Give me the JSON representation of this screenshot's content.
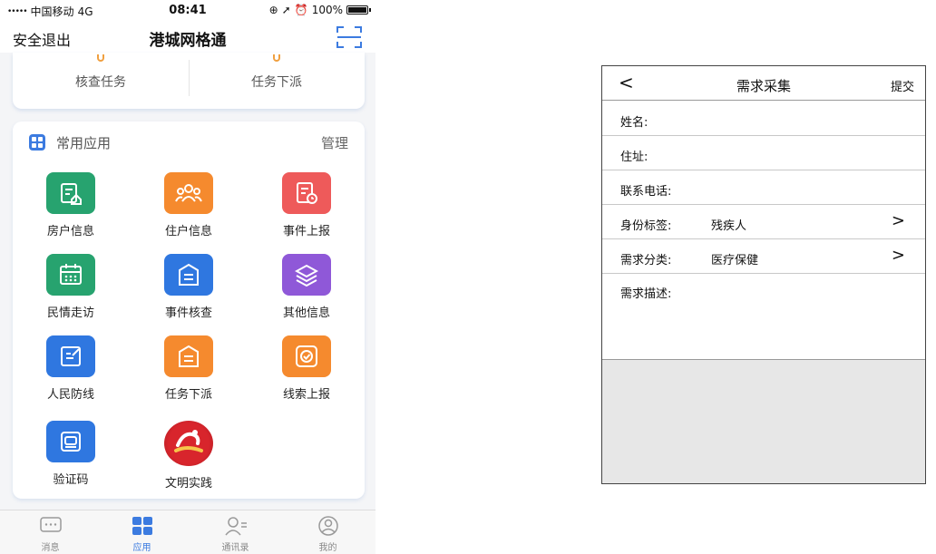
{
  "status_bar": {
    "signal": "•••••",
    "carrier": "中国移动",
    "network": "4G",
    "time": "08:41",
    "battery": "100%"
  },
  "nav": {
    "exit": "安全退出",
    "title": "港城网格通",
    "scan_icon": "scan-icon"
  },
  "top_card": {
    "items": [
      {
        "label": "核查任务"
      },
      {
        "label": "任务下派"
      }
    ]
  },
  "apps": {
    "title": "常用应用",
    "manage": "管理",
    "items": [
      {
        "label": "房户信息",
        "color": "#27a36f",
        "icon": "house-info-icon"
      },
      {
        "label": "住户信息",
        "color": "#f58a2e",
        "icon": "residents-icon"
      },
      {
        "label": "事件上报",
        "color": "#ee5a5a",
        "icon": "event-report-icon"
      },
      {
        "label": "民情走访",
        "color": "#27a36f",
        "icon": "calendar-icon"
      },
      {
        "label": "事件核查",
        "color": "#2f77e0",
        "icon": "clipboard-icon"
      },
      {
        "label": "其他信息",
        "color": "#8f58d8",
        "icon": "layers-icon"
      },
      {
        "label": "人民防线",
        "color": "#2f77e0",
        "icon": "edit-icon"
      },
      {
        "label": "任务下派",
        "color": "#f58a2e",
        "icon": "clipboard-icon"
      },
      {
        "label": "线索上报",
        "color": "#f58a2e",
        "icon": "check-circle-icon"
      },
      {
        "label": "验证码",
        "color": "#2f77e0",
        "icon": "inbox-icon"
      },
      {
        "label": "文明实践",
        "color": "#d8252c",
        "icon": "civilization-logo-icon"
      }
    ]
  },
  "tabbar": {
    "items": [
      {
        "label": "消息",
        "icon": "message-icon",
        "active": false
      },
      {
        "label": "应用",
        "icon": "apps-grid-icon",
        "active": true
      },
      {
        "label": "通讯录",
        "icon": "contacts-icon",
        "active": false
      },
      {
        "label": "我的",
        "icon": "profile-icon",
        "active": false
      }
    ]
  },
  "form": {
    "back": "<",
    "title": "需求采集",
    "submit": "提交",
    "rows": [
      {
        "key": "姓名:",
        "value": ""
      },
      {
        "key": "住址:",
        "value": ""
      },
      {
        "key": "联系电话:",
        "value": ""
      },
      {
        "key": "身份标签:",
        "value": "残疾人",
        "arrow": ">"
      },
      {
        "key": "需求分类:",
        "value": "医疗保健",
        "arrow": ">"
      }
    ],
    "description_label": "需求描述:"
  }
}
